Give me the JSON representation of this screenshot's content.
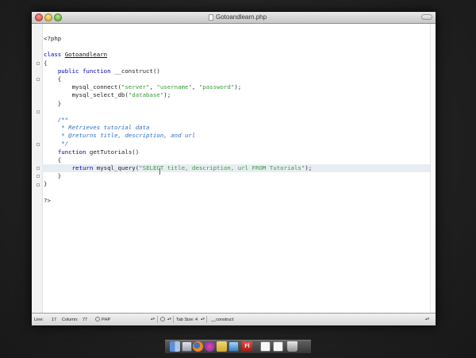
{
  "window": {
    "title": "Gotoandlearn.php"
  },
  "code": {
    "lines": [
      [
        {
          "t": "<?php"
        }
      ],
      [
        {
          "t": ""
        }
      ],
      [
        {
          "t": "class",
          "k": "kw"
        },
        {
          "t": " "
        },
        {
          "t": "Gotoandlearn",
          "k": "cls"
        }
      ],
      [
        {
          "t": "{"
        }
      ],
      [
        {
          "t": "    "
        },
        {
          "t": "public function",
          "k": "kw"
        },
        {
          "t": " __construct()"
        }
      ],
      [
        {
          "t": "    {"
        }
      ],
      [
        {
          "t": "        mysql_connect("
        },
        {
          "t": "\"server\"",
          "k": "str"
        },
        {
          "t": ", "
        },
        {
          "t": "\"username\"",
          "k": "str"
        },
        {
          "t": ", "
        },
        {
          "t": "\"password\"",
          "k": "str"
        },
        {
          "t": ");"
        }
      ],
      [
        {
          "t": "        mysql_select_db("
        },
        {
          "t": "\"database\"",
          "k": "str"
        },
        {
          "t": ");"
        }
      ],
      [
        {
          "t": "    }"
        }
      ],
      [
        {
          "t": ""
        }
      ],
      [
        {
          "t": "    "
        },
        {
          "t": "/**",
          "k": "cm"
        }
      ],
      [
        {
          "t": "     * Retrieves tutorial data",
          "k": "cm"
        }
      ],
      [
        {
          "t": "     * @returns title, description, and url",
          "k": "cm"
        }
      ],
      [
        {
          "t": "     */",
          "k": "cm"
        }
      ],
      [
        {
          "t": "    "
        },
        {
          "t": "function",
          "k": "kw"
        },
        {
          "t": " getTutorials()"
        }
      ],
      [
        {
          "t": "    {"
        }
      ],
      [
        {
          "t": "        "
        },
        {
          "t": "return",
          "k": "kw"
        },
        {
          "t": " mysql_query("
        },
        {
          "t": "\"SELECT title, description, url FROM Tutorials\"",
          "k": "str"
        },
        {
          "t": ");"
        }
      ],
      [
        {
          "t": "    }"
        }
      ],
      [
        {
          "t": "}"
        }
      ],
      [
        {
          "t": ""
        }
      ],
      [
        {
          "t": "?>"
        }
      ]
    ],
    "highlighted_line": 16,
    "fold_markers_at_lines": [
      3,
      5,
      9,
      13,
      16,
      17,
      18
    ]
  },
  "status": {
    "line_label": "Line:",
    "line_value": "17",
    "column_label": "Column:",
    "column_value": "77",
    "language": "PHP",
    "tab_size_label": "Tab Size:",
    "tab_size_value": "4",
    "symbol": "__construct"
  },
  "dock": {
    "flash_label": "Fl"
  }
}
